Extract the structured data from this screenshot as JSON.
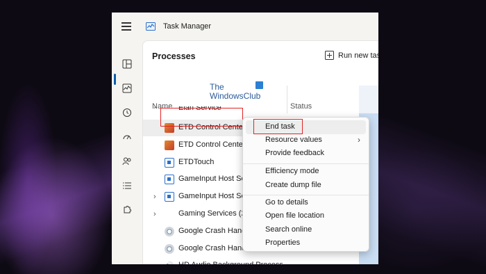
{
  "app": {
    "title": "Task Manager"
  },
  "page": {
    "title": "Processes",
    "run_new_task": "Run new tas"
  },
  "watermark": {
    "line1": "The",
    "line2": "WindowsClub"
  },
  "table": {
    "col_name": "Name",
    "col_status": "Status",
    "partial_row": "Elan Service",
    "rows": [
      {
        "label": "ETD Control Center",
        "icon": "etd-control-icon",
        "expandable": false,
        "highlighted": true
      },
      {
        "label": "ETD Control Center",
        "icon": "etd-control-icon",
        "expandable": false,
        "highlighted": false
      },
      {
        "label": "ETDTouch",
        "icon": "window-app-icon",
        "expandable": false,
        "highlighted": false
      },
      {
        "label": "GameInput Host Service",
        "icon": "window-app-icon",
        "expandable": false,
        "highlighted": false
      },
      {
        "label": "GameInput Host Service",
        "icon": "window-app-icon",
        "expandable": true,
        "highlighted": false
      },
      {
        "label": "Gaming Services (2)",
        "icon": "",
        "expandable": true,
        "highlighted": false
      },
      {
        "label": "Google Crash Handler",
        "icon": "google-crash-icon",
        "expandable": false,
        "highlighted": false
      },
      {
        "label": "Google Crash Handler",
        "icon": "google-crash-icon",
        "expandable": false,
        "highlighted": false
      },
      {
        "label": "HD Audio Background Process",
        "icon": "speaker-icon",
        "expandable": false,
        "highlighted": false
      }
    ]
  },
  "context_menu": {
    "end_task": "End task",
    "resource_values": "Resource values",
    "provide_feedback": "Provide feedback",
    "efficiency_mode": "Efficiency mode",
    "create_dump_file": "Create dump file",
    "go_to_details": "Go to details",
    "open_file_location": "Open file location",
    "search_online": "Search online",
    "properties": "Properties"
  },
  "colors": {
    "accent": "#0b5cad",
    "annotation_red": "#e32222",
    "column_highlight": "#c9ddf3"
  }
}
